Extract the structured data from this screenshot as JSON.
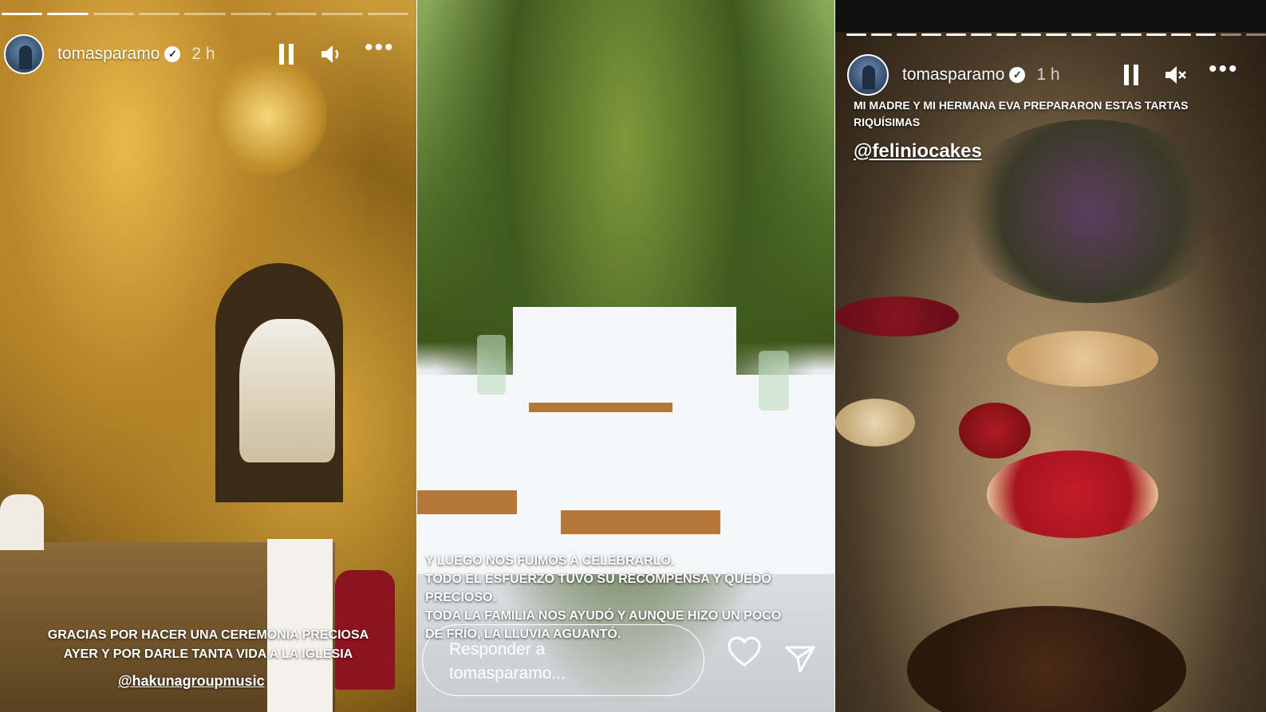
{
  "stories": [
    {
      "username": "tomasparamo",
      "time": "2 h",
      "progress": {
        "segments": 9,
        "viewed": 2
      },
      "caption_lines": [
        "GRACIAS POR HACER UNA CEREMONIA PRECIOSA",
        "AYER Y POR DARLE TANTA VIDA A LA IGLESIA"
      ],
      "mention": "@hakunagroupmusic",
      "sound_icon": "volume-on-icon"
    },
    {
      "caption_lines": [
        "Y LUEGO NOS FUIMOS A CELEBRARLO.",
        "TODO EL ESFUERZO TUVO SU RECOMPENSA Y QUEDÓ",
        "PRECIOSO.",
        "TODA LA FAMILIA NOS AYUDÓ Y AUNQUE HIZO UN POCO",
        "DE FRÍO, LA LLUVIA AGUANTÓ."
      ],
      "reply_placeholder_line1": "Responder a",
      "reply_placeholder_line2": "tomasparamo..."
    },
    {
      "username": "tomasparamo",
      "time": "1 h",
      "progress": {
        "segments": 17,
        "viewed": 15
      },
      "caption_lines": [
        "MI MADRE Y MI HERMANA EVA PREPARARON ESTAS TARTAS",
        "RIQUÍSIMAS"
      ],
      "mention": "@feliniocakes",
      "sound_icon": "volume-muted-icon"
    }
  ],
  "colors": {
    "text": "#ffffff",
    "progress_active": "#ffffff",
    "progress_inactive": "rgba(255,255,255,0.45)"
  }
}
